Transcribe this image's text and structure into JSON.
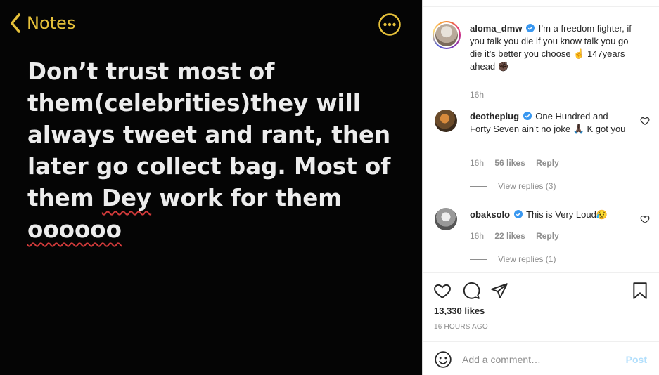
{
  "post_image": {
    "back_label": "Notes",
    "accent_color": "#e6c13a",
    "lines": [
      "Don’t trust most of",
      "them(celebrities)they will",
      "always tweet and rant, then",
      "later go collect bag. Most of"
    ],
    "line5_before": "them ",
    "line5_misspelled": "Dey",
    "line5_after": " work for them",
    "line6_misspelled": "oooooo"
  },
  "caption": {
    "username": "aloma_dmw",
    "text": "I’m a freedom fighter, if you talk you die if you know talk you go die it’s better you choose ☝ 147years ahead ✊🏿",
    "time": "16h"
  },
  "comments": [
    {
      "username": "deotheplug",
      "text": "One Hundred and Forty Seven ain’t no joke 🙏🏿 K got you",
      "time": "16h",
      "likes": "56 likes",
      "reply": "Reply",
      "view_replies": "View replies (3)"
    },
    {
      "username": "obaksolo",
      "text": "This is Very Loud😥",
      "time": "16h",
      "likes": "22 likes",
      "reply": "Reply",
      "view_replies": "View replies (1)"
    }
  ],
  "actions": {
    "likes": "13,330 likes",
    "time_ago": "16 HOURS AGO"
  },
  "add_comment": {
    "placeholder": "Add a comment…",
    "post_label": "Post"
  },
  "colors": {
    "verified": "#3897f0",
    "post_disabled": "#b2dffc"
  },
  "icons": [
    "chevron-left-icon",
    "more-icon",
    "verified-icon",
    "heart-icon",
    "comment-icon",
    "share-icon",
    "bookmark-icon",
    "emoji-icon"
  ]
}
